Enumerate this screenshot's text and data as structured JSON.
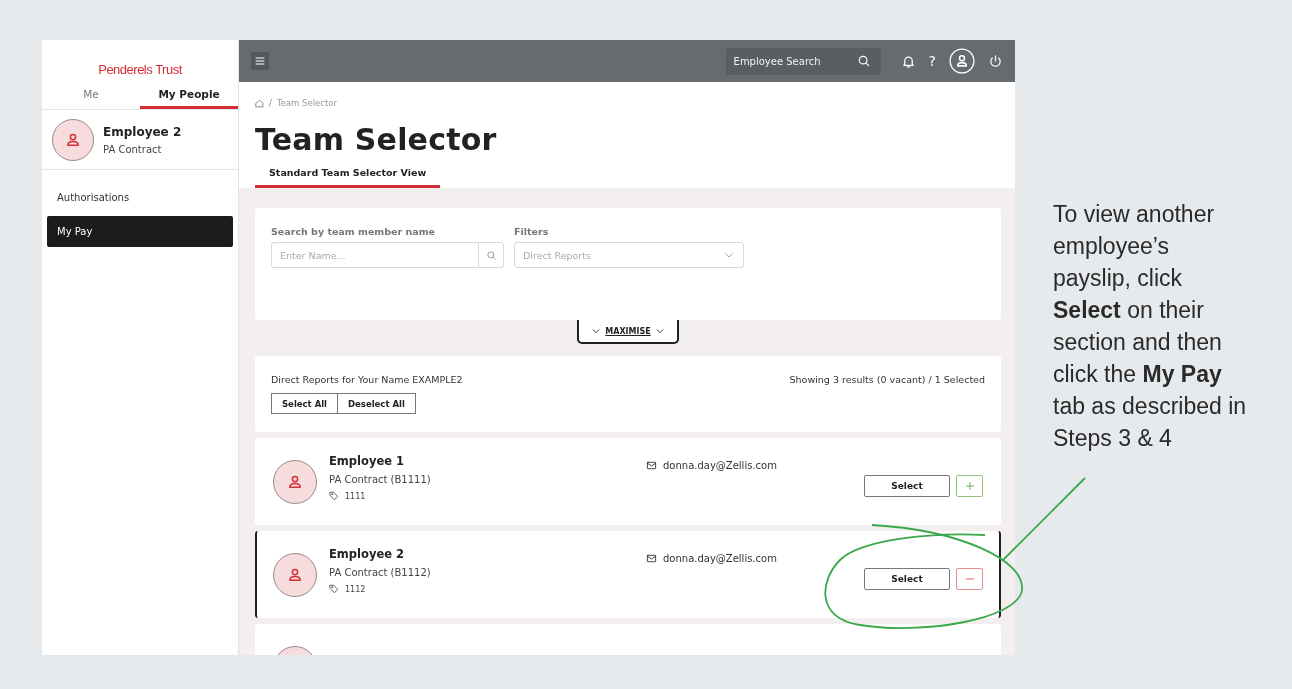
{
  "sidebar": {
    "logo": "Penderels Trust",
    "tabs": [
      {
        "label": "Me",
        "selected": false
      },
      {
        "label": "My People",
        "selected": true
      }
    ],
    "profile": {
      "name": "Employee 2",
      "contract": "PA Contract"
    },
    "items": [
      {
        "label": "Authorisations",
        "selected": false
      },
      {
        "label": "My Pay",
        "selected": true
      }
    ]
  },
  "topbar": {
    "search": {
      "placeholder": "Employee Search"
    },
    "help": "?"
  },
  "breadcrumb": {
    "separator": "/",
    "items": [
      "Team Selector"
    ]
  },
  "title": "Team Selector",
  "tabs": [
    {
      "label": "Standard Team Selector View",
      "selected": true
    }
  ],
  "filters": {
    "search_label": "Search by team member name",
    "search_placeholder": "Enter Name...",
    "filter_label": "Filters",
    "filter_value": "Direct Reports",
    "toggle": "MAXIMISE"
  },
  "reports": {
    "heading": "Direct Reports for Your Name EXAMPLE2",
    "summary": "Showing 3 results (0 vacant) / 1 Selected",
    "buttons": [
      "Select All",
      "Deselect All"
    ]
  },
  "employees": [
    {
      "kind": "full",
      "name": "Employee 1",
      "contract": "PA Contract (B1111)",
      "id": "1111",
      "email": "donna.day@Zellis.com",
      "button": "Select",
      "selected": false
    },
    {
      "kind": "full",
      "name": "Employee 2",
      "contract": "PA Contract (B1112)",
      "id": "1112",
      "email": "donna.day@Zellis.com",
      "button": "Select",
      "selected": true
    },
    {
      "kind": "partial"
    }
  ],
  "callout": {
    "text": "To view another employee’s payslip, click **Select** on their section and then click the **My Pay** tab as described in Steps 3 & 4"
  }
}
